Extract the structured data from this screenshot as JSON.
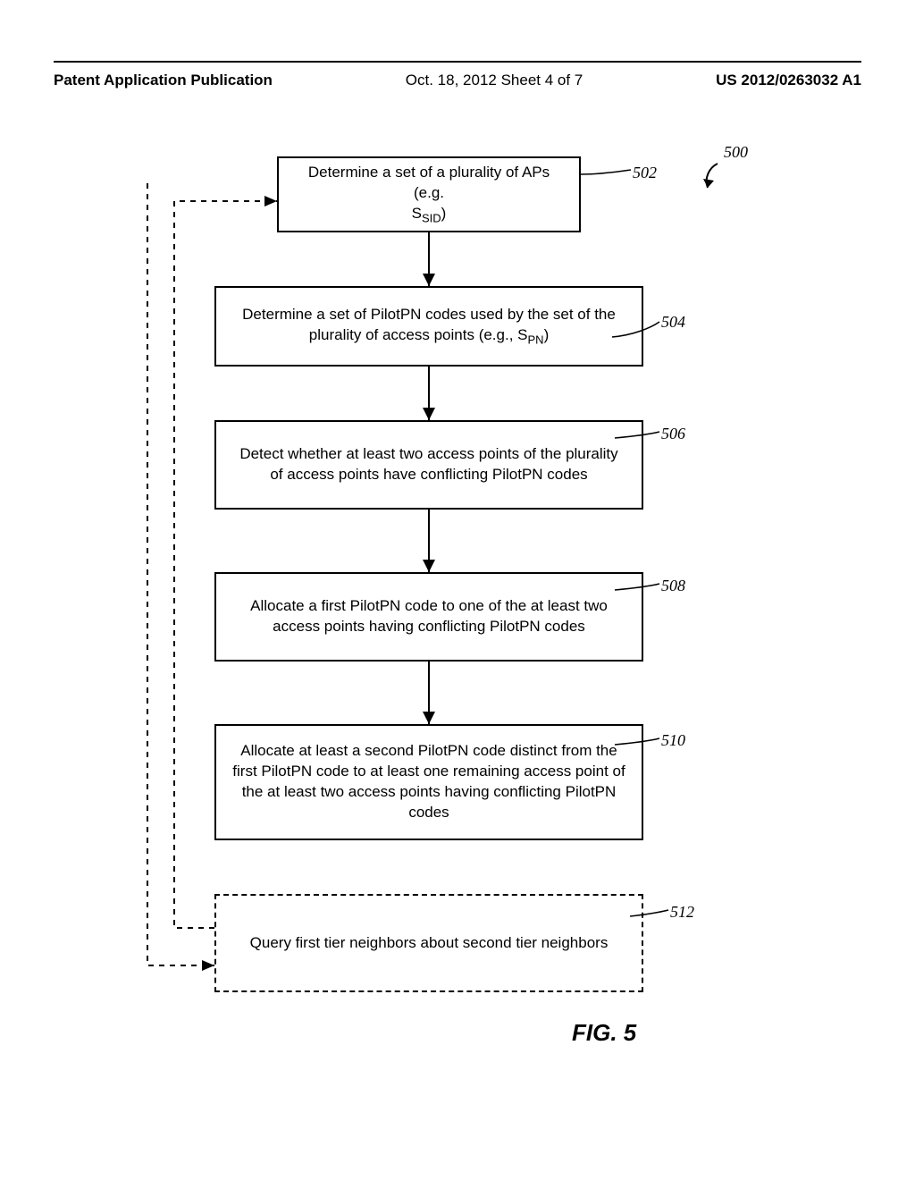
{
  "header": {
    "left": "Patent Application Publication",
    "mid": "Oct. 18, 2012  Sheet 4 of 7",
    "right": "US 2012/0263032 A1"
  },
  "refs": {
    "r500": "500",
    "r502": "502",
    "r504": "504",
    "r506": "506",
    "r508": "508",
    "r510": "510",
    "r512": "512"
  },
  "boxes": {
    "b502_a": "Determine a set of a plurality of APs (e.g.",
    "b502_b": "S",
    "b502_c": "SID",
    "b502_d": ")",
    "b504_a": "Determine a set of PilotPN codes used by the set of the plurality of access points (e.g., S",
    "b504_b": "PN",
    "b504_c": ")",
    "b506": "Detect whether at least two access points of the plurality of access points have conflicting PilotPN codes",
    "b508": "Allocate a first PilotPN code to one of the at least two access points having conflicting PilotPN codes",
    "b510": "Allocate at least a second PilotPN code distinct from the first PilotPN code to at least one remaining access point of the at least two access points having conflicting PilotPN codes",
    "b512": "Query first tier neighbors about second tier neighbors"
  },
  "figure_label": "FIG. 5",
  "chart_data": {
    "type": "flowchart",
    "title": "FIG. 5",
    "nodes": [
      {
        "id": "502",
        "text": "Determine a set of a plurality of APs (e.g. S_SID)",
        "style": "solid"
      },
      {
        "id": "504",
        "text": "Determine a set of PilotPN codes used by the set of the plurality of access points (e.g., S_PN)",
        "style": "solid"
      },
      {
        "id": "506",
        "text": "Detect whether at least two access points of the plurality of access points have conflicting PilotPN codes",
        "style": "solid"
      },
      {
        "id": "508",
        "text": "Allocate a first PilotPN code to one of the at least two access points having conflicting PilotPN codes",
        "style": "solid"
      },
      {
        "id": "510",
        "text": "Allocate at least a second PilotPN code distinct from the first PilotPN code to at least one remaining access point of the at least two access points having conflicting PilotPN codes",
        "style": "solid"
      },
      {
        "id": "512",
        "text": "Query first tier neighbors about second tier neighbors",
        "style": "dashed"
      }
    ],
    "edges": [
      {
        "from": "502",
        "to": "504",
        "style": "solid"
      },
      {
        "from": "504",
        "to": "506",
        "style": "solid"
      },
      {
        "from": "506",
        "to": "508",
        "style": "solid"
      },
      {
        "from": "508",
        "to": "510",
        "style": "solid"
      },
      {
        "from": "512",
        "to": "502",
        "style": "dashed",
        "note": "loop back"
      },
      {
        "from": "start",
        "to": "512",
        "style": "dashed",
        "note": "entry dashed"
      }
    ],
    "overall_ref": "500"
  }
}
